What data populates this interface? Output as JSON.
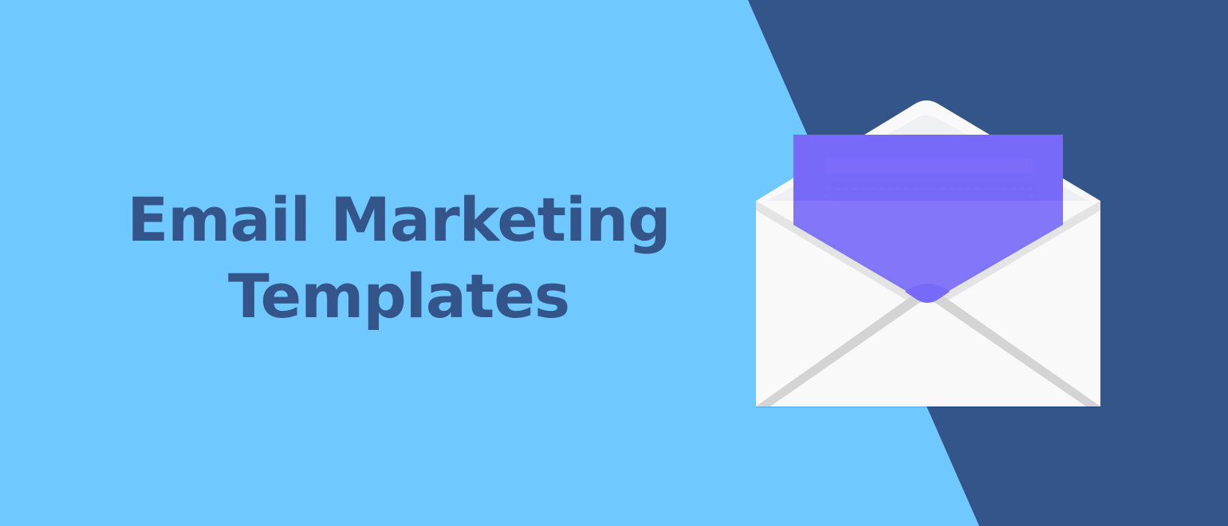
{
  "headline": {
    "line1": "Email Marketing",
    "line2": "Templates"
  },
  "illustration": {
    "icon": "open-envelope-icon"
  },
  "colors": {
    "background_light": "#70C9FE",
    "background_dark": "#34558A",
    "headline_text": "#34558A",
    "envelope_white": "#F9F9F9",
    "envelope_shadow": "#D4D4D4",
    "letter_purple": "#786AF8",
    "letter_bar_light": "#9A8FFB",
    "letter_bar_dark": "#6656DD"
  }
}
